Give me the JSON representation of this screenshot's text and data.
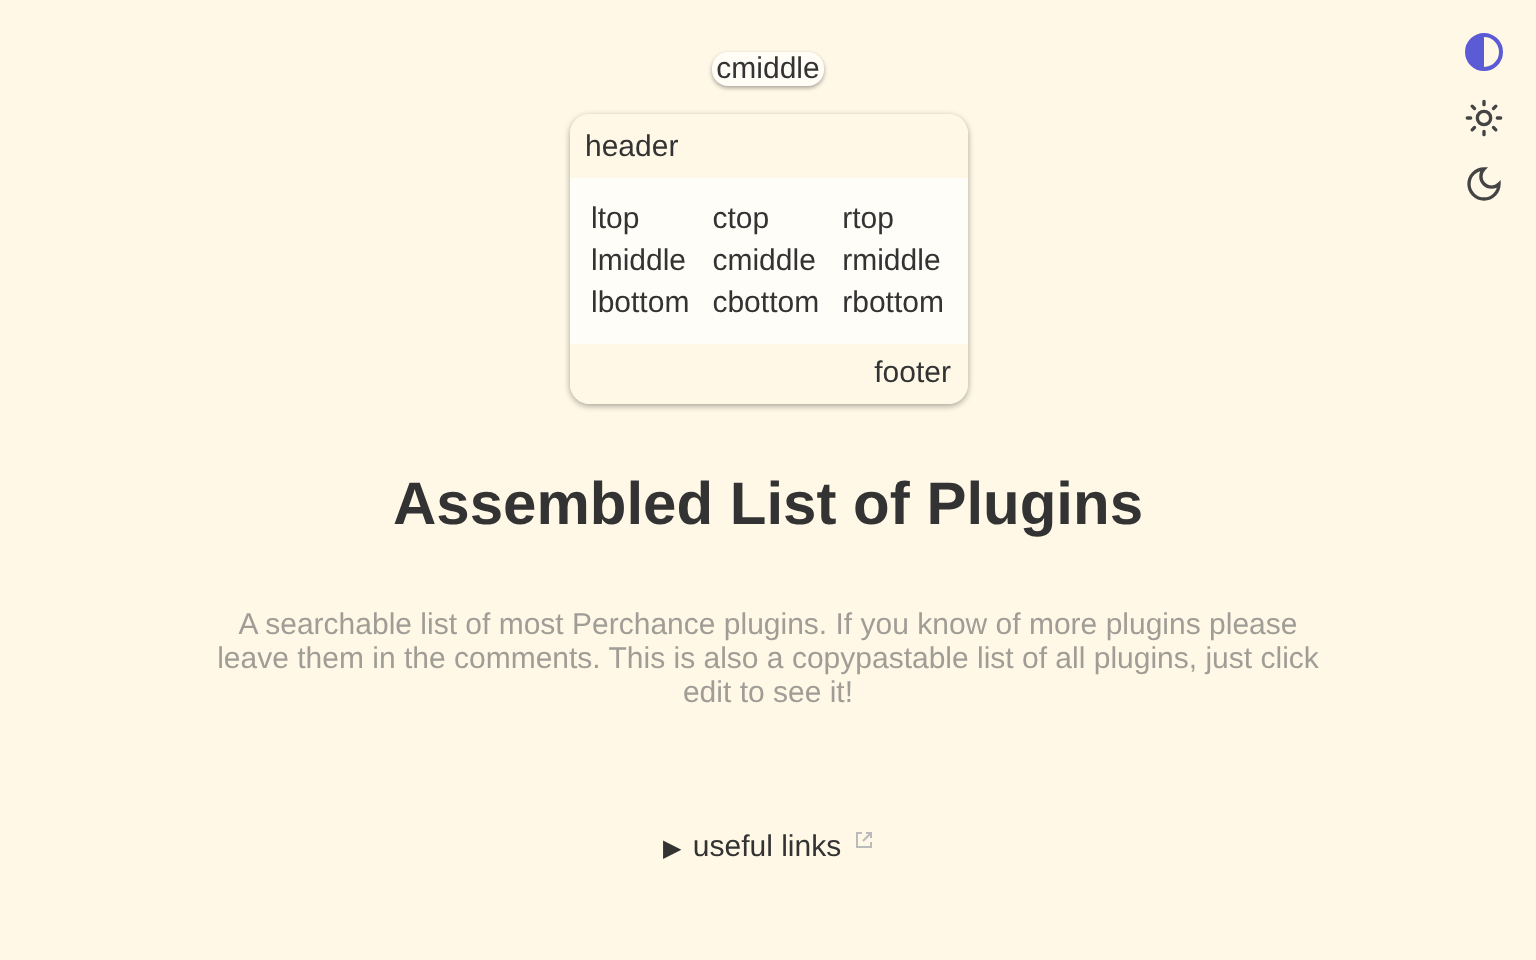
{
  "theme_buttons": [
    {
      "kind": "auto",
      "selected": true
    },
    {
      "kind": "light",
      "selected": false
    },
    {
      "kind": "dark",
      "selected": false
    }
  ],
  "badge": "cmiddle",
  "card": {
    "header": "header",
    "grid": [
      [
        "ltop",
        "ctop",
        "rtop"
      ],
      [
        "lmiddle",
        "cmiddle",
        "rmiddle"
      ],
      [
        "lbottom",
        "cbottom",
        "rbottom"
      ]
    ],
    "footer": "footer"
  },
  "title": "Assembled List of Plugins",
  "description": "A searchable list of most Perchance plugins. If you know of more plugins please leave them in the comments. This is also a copypastable list of all plugins, just click edit to see it!",
  "details": {
    "marker": "▶",
    "label": "useful links",
    "expanded": false
  }
}
